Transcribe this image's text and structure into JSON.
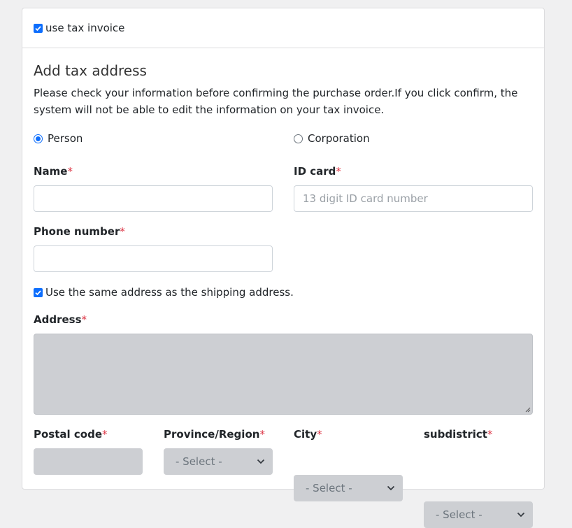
{
  "header": {
    "use_tax_invoice_label": "use tax invoice",
    "use_tax_invoice_checked": true
  },
  "form": {
    "title": "Add tax address",
    "description": "Please check your information before confirming the purchase order.If you click confirm, the system will not be able to edit the information on your tax invoice.",
    "type_options": [
      {
        "label": "Person",
        "selected": true
      },
      {
        "label": "Corporation",
        "selected": false
      }
    ],
    "required_mark": "*",
    "name_label": "Name",
    "name_value": "",
    "id_card_label": "ID card",
    "id_card_placeholder": "13 digit ID card number",
    "phone_label": "Phone number",
    "phone_value": "",
    "same_address_label": "Use the same address as the shipping address.",
    "same_address_checked": true,
    "address_label": "Address",
    "postal_code_label": "Postal code",
    "province_label": "Province/Region",
    "province_value": "- Select -",
    "city_label": "City",
    "city_value": "- Select -",
    "subdistrict_label": "subdistrict",
    "subdistrict_value": "- Select -"
  },
  "colors": {
    "accent": "#0d6efd",
    "required": "#dc3545",
    "disabled_fill": "#cdcfd3"
  }
}
